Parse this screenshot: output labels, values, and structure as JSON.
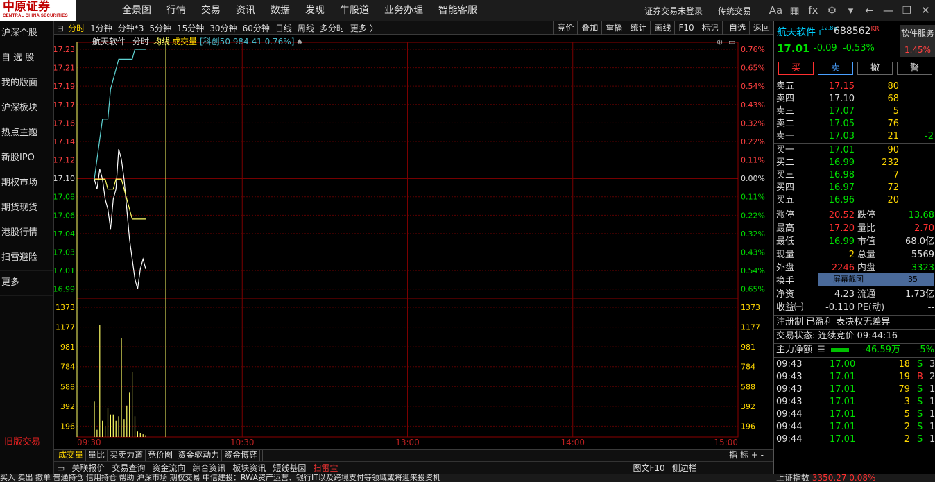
{
  "app": {
    "logo_cn": "中原证券",
    "logo_en": "CENTRAL CHINA SECURITIES"
  },
  "nav": [
    "全景图",
    "行情",
    "交易",
    "资讯",
    "数据",
    "发现",
    "牛股道",
    "业务办理",
    "智能客服"
  ],
  "top_right": {
    "login_status": "证券交易未登录",
    "mode": "传统交易"
  },
  "sidebar": [
    "沪深个股",
    "自 选 股",
    "我的版面",
    "沪深板块",
    "热点主题",
    "新股IPO",
    "期权市场",
    "期货现货",
    "港股行情",
    "扫雷避险",
    "更多"
  ],
  "old_trade": "旧版交易",
  "toolbar": {
    "periods": [
      "分时",
      "1分钟",
      "分钟*3",
      "5分钟",
      "15分钟",
      "30分钟",
      "60分钟",
      "日线",
      "周线",
      "多分时",
      "更多 〉"
    ],
    "right": [
      "竞价",
      "叠加",
      "重播",
      "统计",
      "画线",
      "F10",
      "标记",
      "-自选",
      "返回"
    ]
  },
  "chart_header": {
    "name": "航天软件",
    "t1": "分时",
    "t2": "均线",
    "t3": "成交量",
    "idx": "[科创50 984.41 0.76%]"
  },
  "chart_data": {
    "type": "line",
    "title": "航天软件 分时",
    "x_ticks": [
      "09:30",
      "10:30",
      "13:00",
      "14:00",
      "15:00"
    ],
    "price_ticks": [
      "17.23",
      "17.21",
      "17.19",
      "17.17",
      "17.16",
      "17.14",
      "17.12",
      "17.10",
      "17.08",
      "17.06",
      "17.04",
      "17.03",
      "17.01",
      "16.99"
    ],
    "pct_ticks": [
      "0.76%",
      "0.65%",
      "0.54%",
      "0.43%",
      "0.32%",
      "0.22%",
      "0.11%",
      "0.00%",
      "0.11%",
      "0.22%",
      "0.32%",
      "0.43%",
      "0.54%",
      "0.65%"
    ],
    "vol_ticks": [
      "1373",
      "1177",
      "981",
      "784",
      "588",
      "392",
      "196"
    ],
    "prev_close": 17.1,
    "price_range": [
      16.975,
      17.235
    ],
    "vol_max": 1470,
    "series": [
      {
        "name": "航天软件",
        "color": "#ffffff",
        "values": [
          17.1,
          17.09,
          17.11,
          17.1,
          17.08,
          17.07,
          17.05,
          17.08,
          17.09,
          17.13,
          17.12,
          17.1,
          17.07,
          17.04,
          17.02,
          17.0,
          16.99,
          17.01,
          17.02,
          17.01
        ]
      },
      {
        "name": "均线",
        "color": "#ffff66",
        "values": [
          17.1,
          17.1,
          17.1,
          17.1,
          17.1,
          17.09,
          17.09,
          17.09,
          17.1,
          17.1,
          17.1,
          17.09,
          17.08,
          17.07,
          17.06,
          17.06,
          17.06,
          17.06,
          17.06,
          17.06
        ]
      },
      {
        "name": "科创50",
        "color": "#5fd3d3",
        "values": [
          17.1,
          17.12,
          17.14,
          17.16,
          17.16,
          17.16,
          17.19,
          17.2,
          17.21,
          17.22,
          17.22,
          17.22,
          17.22,
          17.22,
          17.22,
          17.23,
          17.23,
          17.24,
          17.25,
          17.26
        ]
      }
    ],
    "volume": [
      400,
      80,
      1250,
      180,
      120,
      320,
      250,
      250,
      180,
      230,
      1100,
      200,
      350,
      500,
      720,
      230,
      60,
      40,
      30,
      20
    ]
  },
  "bottom_tabs": [
    "成交量",
    "量比",
    "买卖力道",
    "竞价图",
    "资金驱动力",
    "资金博弈"
  ],
  "bottom_right": "指 标  +  -",
  "status_row": [
    "关联报价",
    "交易查询",
    "资金流向",
    "综合资讯",
    "板块资讯",
    "短线基因",
    "扫雷宝",
    "图文F10",
    "侧边栏"
  ],
  "task_row": "买入    卖出    撤单    普通持仓    信用持仓    帮助    沪深市场    期权交易      中信建投：RWA资产运营、银行IT以及跨境支付等领域或将迎来投资机",
  "index_bar": {
    "name": "上证指数",
    "value": "3350.27",
    "pct": "0.08%"
  },
  "panel": {
    "name": "航天软件",
    "mark": "i",
    "small": "12.86",
    "code": "688562",
    "kr": "KR",
    "svc": "软件服务",
    "svc_pct": "1.45%",
    "price": "17.01",
    "chg": "-0.09",
    "pct": "-0.53%",
    "buttons": [
      "买",
      "卖",
      "撤",
      "警"
    ],
    "asks": [
      [
        "卖五",
        "17.15",
        "80"
      ],
      [
        "卖四",
        "17.10",
        "68"
      ],
      [
        "卖三",
        "17.07",
        "5"
      ],
      [
        "卖二",
        "17.05",
        "76"
      ],
      [
        "卖一",
        "17.03",
        "21",
        "-2"
      ]
    ],
    "bids": [
      [
        "买一",
        "17.01",
        "90"
      ],
      [
        "买二",
        "16.99",
        "232"
      ],
      [
        "买三",
        "16.98",
        "7"
      ],
      [
        "买四",
        "16.97",
        "72"
      ],
      [
        "买五",
        "16.96",
        "20"
      ]
    ],
    "stats": [
      [
        "涨停",
        "20.52",
        "跌停",
        "13.68"
      ],
      [
        "最高",
        "17.20",
        "量比",
        "2.70"
      ],
      [
        "最低",
        "16.99",
        "市值",
        "68.0亿"
      ],
      [
        "现量",
        "2",
        "总量",
        "5569"
      ],
      [
        "外盘",
        "2246",
        "内盘",
        "3323"
      ],
      [
        "换手",
        "0.",
        "",
        ".00亿"
      ],
      [
        "净资",
        "4.23",
        "流通",
        "1.73亿"
      ],
      [
        "收益㈠",
        "-0.110",
        "PE(动)",
        "--"
      ]
    ],
    "popup": "屏幕截图",
    "popup_num": "35",
    "tags": "注册制 已盈利 表决权无差异",
    "status": "交易状态: 连续竞价 09:44:16",
    "main_label": "主力净额",
    "main_val": "-46.59万",
    "main_pct": "-5%",
    "ticks": [
      [
        "09:43",
        "17.00",
        "18",
        "S",
        "3"
      ],
      [
        "09:43",
        "17.01",
        "19",
        "B",
        "2"
      ],
      [
        "09:43",
        "17.01",
        "79",
        "S",
        "1"
      ],
      [
        "09:43",
        "17.01",
        "3",
        "S",
        "1"
      ],
      [
        "09:44",
        "17.01",
        "5",
        "S",
        "1"
      ],
      [
        "09:44",
        "17.01",
        "2",
        "S",
        "1"
      ],
      [
        "09:44",
        "17.01",
        "2",
        "S",
        "1"
      ]
    ]
  }
}
